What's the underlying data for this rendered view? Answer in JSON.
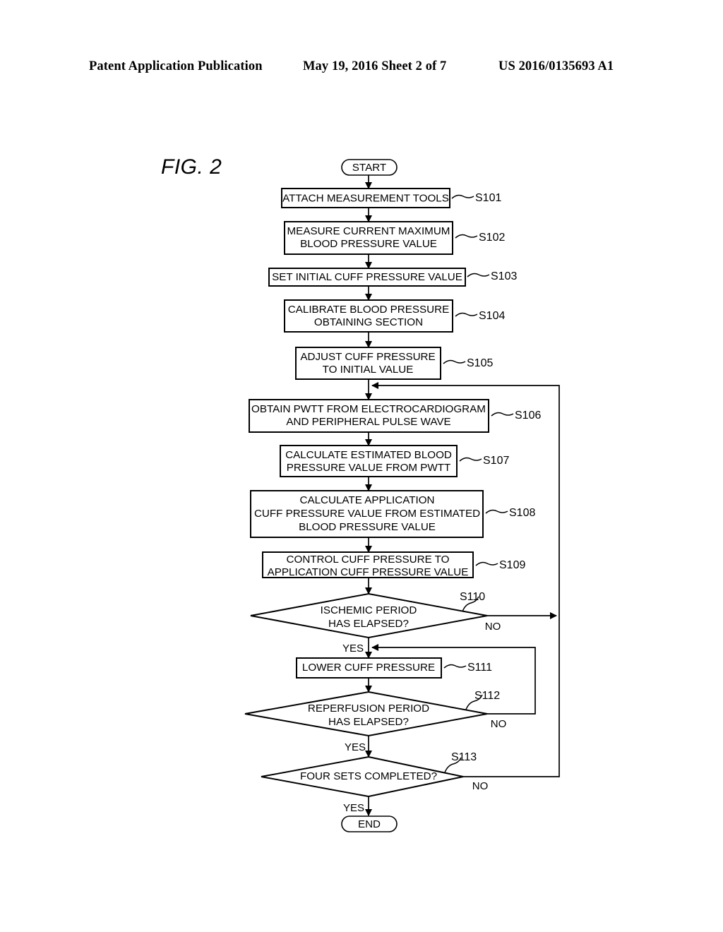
{
  "header": {
    "publication": "Patent Application Publication",
    "date_sheet": "May 19, 2016  Sheet 2 of 7",
    "patent_number": "US 2016/0135693 A1"
  },
  "figure": {
    "label": "FIG. 2"
  },
  "flowchart": {
    "start_label": "START",
    "end_label": "END",
    "yes_label": "YES",
    "no_label": "NO",
    "steps": [
      {
        "id": "S101",
        "type": "process",
        "lines": [
          "ATTACH MEASUREMENT TOOLS"
        ]
      },
      {
        "id": "S102",
        "type": "process",
        "lines": [
          "MEASURE CURRENT MAXIMUM",
          "BLOOD PRESSURE VALUE"
        ]
      },
      {
        "id": "S103",
        "type": "process",
        "lines": [
          "SET INITIAL CUFF PRESSURE VALUE"
        ]
      },
      {
        "id": "S104",
        "type": "process",
        "lines": [
          "CALIBRATE BLOOD PRESSURE",
          "OBTAINING SECTION"
        ]
      },
      {
        "id": "S105",
        "type": "process",
        "lines": [
          "ADJUST CUFF PRESSURE",
          "TO INITIAL VALUE"
        ]
      },
      {
        "id": "S106",
        "type": "process",
        "lines": [
          "OBTAIN PWTT FROM ELECTROCARDIOGRAM",
          "AND PERIPHERAL PULSE WAVE"
        ]
      },
      {
        "id": "S107",
        "type": "process",
        "lines": [
          "CALCULATE ESTIMATED BLOOD",
          "PRESSURE VALUE FROM PWTT"
        ]
      },
      {
        "id": "S108",
        "type": "process",
        "lines": [
          "CALCULATE APPLICATION",
          "CUFF PRESSURE VALUE FROM ESTIMATED",
          "BLOOD PRESSURE VALUE"
        ]
      },
      {
        "id": "S109",
        "type": "process",
        "lines": [
          "CONTROL CUFF PRESSURE TO",
          "APPLICATION CUFF PRESSURE VALUE"
        ]
      },
      {
        "id": "S110",
        "type": "decision",
        "lines": [
          "ISCHEMIC PERIOD",
          "HAS ELAPSED?"
        ]
      },
      {
        "id": "S111",
        "type": "process",
        "lines": [
          "LOWER CUFF PRESSURE"
        ]
      },
      {
        "id": "S112",
        "type": "decision",
        "lines": [
          "REPERFUSION PERIOD",
          "HAS ELAPSED?"
        ]
      },
      {
        "id": "S113",
        "type": "decision",
        "lines": [
          "FOUR SETS COMPLETED?"
        ]
      }
    ]
  },
  "colors": {
    "ink": "#000000",
    "paper": "#ffffff"
  }
}
